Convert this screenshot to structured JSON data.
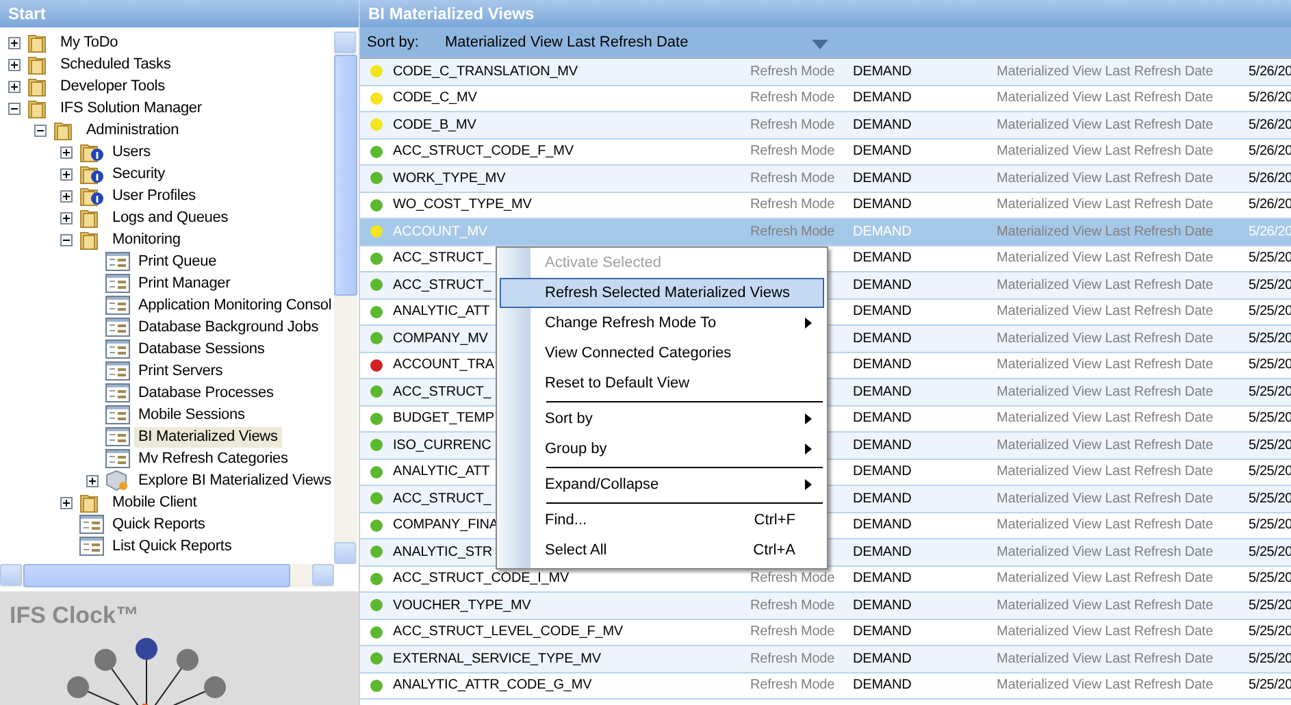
{
  "start_panel": {
    "title": "Start",
    "tree": [
      {
        "label": "My ToDo",
        "kind": "folder",
        "expanded": false,
        "selected": false
      },
      {
        "label": "Scheduled Tasks",
        "kind": "folder",
        "expanded": false,
        "selected": false
      },
      {
        "label": "Developer Tools",
        "kind": "folder",
        "expanded": false,
        "selected": false
      },
      {
        "label": "IFS Solution Manager",
        "kind": "folder",
        "expanded": true,
        "selected": false,
        "children": [
          {
            "label": "Administration",
            "kind": "folder",
            "expanded": true,
            "selected": false,
            "children": [
              {
                "label": "Users",
                "kind": "folder-info",
                "expanded": false,
                "selected": false
              },
              {
                "label": "Security",
                "kind": "folder-info",
                "expanded": false,
                "selected": false
              },
              {
                "label": "User Profiles",
                "kind": "folder-info",
                "expanded": false,
                "selected": false
              },
              {
                "label": "Logs and Queues",
                "kind": "folder",
                "expanded": false,
                "selected": false
              },
              {
                "label": "Monitoring",
                "kind": "folder",
                "expanded": true,
                "selected": false,
                "children": [
                  {
                    "label": "Print Queue",
                    "kind": "window",
                    "selected": false
                  },
                  {
                    "label": "Print Manager",
                    "kind": "window",
                    "selected": false
                  },
                  {
                    "label": "Application Monitoring Consol",
                    "kind": "window",
                    "selected": false
                  },
                  {
                    "label": "Database Background Jobs",
                    "kind": "window",
                    "selected": false
                  },
                  {
                    "label": "Database Sessions",
                    "kind": "window",
                    "selected": false
                  },
                  {
                    "label": "Print Servers",
                    "kind": "window",
                    "selected": false
                  },
                  {
                    "label": "Database Processes",
                    "kind": "window",
                    "selected": false
                  },
                  {
                    "label": "Mobile Sessions",
                    "kind": "window",
                    "selected": false
                  },
                  {
                    "label": "BI Materialized Views",
                    "kind": "window",
                    "selected": true
                  },
                  {
                    "label": "Mv Refresh Categories",
                    "kind": "window",
                    "selected": false
                  },
                  {
                    "label": "Explore BI Materialized Views",
                    "kind": "cube",
                    "expanded": false,
                    "selected": false
                  }
                ]
              },
              {
                "label": "Mobile Client",
                "kind": "folder",
                "expanded": false,
                "selected": false
              },
              {
                "label": "Quick Reports",
                "kind": "window",
                "selected": false
              },
              {
                "label": "List Quick Reports",
                "kind": "window",
                "selected": false
              }
            ]
          }
        ]
      }
    ],
    "clock_title": "IFS Clock™"
  },
  "views_panel": {
    "title": "BI Materialized Views",
    "sort_label": "Sort by:",
    "sort_value": "Materialized View Last Refresh Date",
    "rows": [
      {
        "name": "CODE_C_TRANSLATION_MV",
        "color": "#f2e41c",
        "mode_label": "Refresh Mode",
        "mode": "DEMAND",
        "date_label": "Materialized View Last Refresh Date",
        "date": "5/26/20",
        "selected": false
      },
      {
        "name": "CODE_C_MV",
        "color": "#f2e41c",
        "mode_label": "Refresh Mode",
        "mode": "DEMAND",
        "date_label": "Materialized View Last Refresh Date",
        "date": "5/26/20",
        "selected": false
      },
      {
        "name": "CODE_B_MV",
        "color": "#f2e41c",
        "mode_label": "Refresh Mode",
        "mode": "DEMAND",
        "date_label": "Materialized View Last Refresh Date",
        "date": "5/26/20",
        "selected": false
      },
      {
        "name": "ACC_STRUCT_CODE_F_MV",
        "color": "#5cb82e",
        "mode_label": "Refresh Mode",
        "mode": "DEMAND",
        "date_label": "Materialized View Last Refresh Date",
        "date": "5/26/20",
        "selected": false
      },
      {
        "name": "WORK_TYPE_MV",
        "color": "#5cb82e",
        "mode_label": "Refresh Mode",
        "mode": "DEMAND",
        "date_label": "Materialized View Last Refresh Date",
        "date": "5/26/20",
        "selected": false
      },
      {
        "name": "WO_COST_TYPE_MV",
        "color": "#5cb82e",
        "mode_label": "Refresh Mode",
        "mode": "DEMAND",
        "date_label": "Materialized View Last Refresh Date",
        "date": "5/26/20",
        "selected": false
      },
      {
        "name": "ACCOUNT_MV",
        "color": "#f2e41c",
        "mode_label": "Refresh Mode",
        "mode": "DEMAND",
        "date_label": "Materialized View Last Refresh Date",
        "date": "5/26/20",
        "selected": true
      },
      {
        "name": "ACC_STRUCT_",
        "color": "#5cb82e",
        "mode": "DEMAND",
        "date_label": "Materialized View Last Refresh Date",
        "date": "5/25/20",
        "selected": false
      },
      {
        "name": "ACC_STRUCT_",
        "color": "#5cb82e",
        "mode": "DEMAND",
        "date_label": "Materialized View Last Refresh Date",
        "date": "5/25/20",
        "selected": false
      },
      {
        "name": "ANALYTIC_ATT",
        "color": "#5cb82e",
        "mode": "DEMAND",
        "date_label": "Materialized View Last Refresh Date",
        "date": "5/25/20",
        "selected": false
      },
      {
        "name": "COMPANY_MV",
        "color": "#5cb82e",
        "mode": "DEMAND",
        "date_label": "Materialized View Last Refresh Date",
        "date": "5/25/20",
        "selected": false
      },
      {
        "name": "ACCOUNT_TRA",
        "color": "#d42020",
        "mode": "DEMAND",
        "date_label": "Materialized View Last Refresh Date",
        "date": "5/25/20",
        "selected": false
      },
      {
        "name": "ACC_STRUCT_",
        "color": "#5cb82e",
        "mode": "DEMAND",
        "date_label": "Materialized View Last Refresh Date",
        "date": "5/25/20",
        "selected": false
      },
      {
        "name": "BUDGET_TEMP",
        "color": "#5cb82e",
        "mode": "DEMAND",
        "date_label": "Materialized View Last Refresh Date",
        "date": "5/25/20",
        "selected": false
      },
      {
        "name": "ISO_CURRENC",
        "color": "#5cb82e",
        "mode": "DEMAND",
        "date_label": "Materialized View Last Refresh Date",
        "date": "5/25/20",
        "selected": false
      },
      {
        "name": "ANALYTIC_ATT",
        "color": "#5cb82e",
        "mode": "DEMAND",
        "date_label": "Materialized View Last Refresh Date",
        "date": "5/25/20",
        "selected": false
      },
      {
        "name": "ACC_STRUCT_",
        "color": "#5cb82e",
        "mode": "DEMAND",
        "date_label": "Materialized View Last Refresh Date",
        "date": "5/25/20",
        "selected": false
      },
      {
        "name": "COMPANY_FINA",
        "color": "#5cb82e",
        "mode": "DEMAND",
        "date_label": "Materialized View Last Refresh Date",
        "date": "5/25/20",
        "selected": false
      },
      {
        "name": "ANALYTIC_STR",
        "color": "#5cb82e",
        "mode": "DEMAND",
        "date_label": "Materialized View Last Refresh Date",
        "date": "5/25/20",
        "selected": false
      },
      {
        "name": "ACC_STRUCT_CODE_I_MV",
        "color": "#5cb82e",
        "mode_label": "Refresh Mode",
        "mode": "DEMAND",
        "date_label": "Materialized View Last Refresh Date",
        "date": "5/25/20",
        "selected": false
      },
      {
        "name": "VOUCHER_TYPE_MV",
        "color": "#5cb82e",
        "mode_label": "Refresh Mode",
        "mode": "DEMAND",
        "date_label": "Materialized View Last Refresh Date",
        "date": "5/25/20",
        "selected": false
      },
      {
        "name": "ACC_STRUCT_LEVEL_CODE_F_MV",
        "color": "#5cb82e",
        "mode_label": "Refresh Mode",
        "mode": "DEMAND",
        "date_label": "Materialized View Last Refresh Date",
        "date": "5/25/20",
        "selected": false
      },
      {
        "name": "EXTERNAL_SERVICE_TYPE_MV",
        "color": "#5cb82e",
        "mode_label": "Refresh Mode",
        "mode": "DEMAND",
        "date_label": "Materialized View Last Refresh Date",
        "date": "5/25/20",
        "selected": false
      },
      {
        "name": "ANALYTIC_ATTR_CODE_G_MV",
        "color": "#5cb82e",
        "mode_label": "Refresh Mode",
        "mode": "DEMAND",
        "date_label": "Materialized View Last Refresh Date",
        "date": "5/25/20",
        "selected": false
      }
    ],
    "context_menu": [
      {
        "kind": "item",
        "label": "Activate Selected",
        "disabled": true,
        "selected": false
      },
      {
        "kind": "item",
        "label": "Refresh Selected Materialized Views",
        "disabled": false,
        "selected": true
      },
      {
        "kind": "submenu",
        "label": "Change Refresh Mode To",
        "disabled": false,
        "selected": false
      },
      {
        "kind": "item",
        "label": "View Connected Categories",
        "disabled": false,
        "selected": false
      },
      {
        "kind": "item",
        "label": "Reset to Default View",
        "disabled": false,
        "selected": false
      },
      {
        "kind": "separator"
      },
      {
        "kind": "submenu",
        "label": "Sort by",
        "disabled": false,
        "selected": false
      },
      {
        "kind": "submenu",
        "label": "Group by",
        "disabled": false,
        "selected": false
      },
      {
        "kind": "separator"
      },
      {
        "kind": "submenu",
        "label": "Expand/Collapse",
        "disabled": false,
        "selected": false
      },
      {
        "kind": "separator"
      },
      {
        "kind": "item",
        "label": "Find...",
        "shortcut": "Ctrl+F",
        "disabled": false,
        "selected": false
      },
      {
        "kind": "item",
        "label": "Select All",
        "shortcut": "Ctrl+A",
        "disabled": false,
        "selected": false
      }
    ]
  }
}
